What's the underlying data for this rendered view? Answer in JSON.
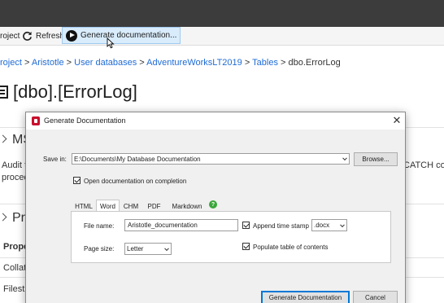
{
  "toolbar": {
    "project_label": "roject",
    "refresh_label": "Refresh",
    "generate_label": "Generate documentation..."
  },
  "breadcrumb": {
    "items": [
      "roject",
      "Aristotle",
      "User databases",
      "AdventureWorksLT2019",
      "Tables",
      "dbo.ErrorLog"
    ],
    "separator": ">"
  },
  "page": {
    "title": "[dbo].[ErrorLog]",
    "section_ms": "MS",
    "desc_line1": "Audit ta",
    "desc_line2": "proced",
    "desc_right": "CATCH co",
    "section_pro": "Pro",
    "col_prope": "Prope",
    "row_collat": "Collati",
    "row_filestr": "Filestr"
  },
  "dialog": {
    "title": "Generate Documentation",
    "close_glyph": "✕",
    "save_in_label": "Save in:",
    "save_in_value": "E:\\Documents\\My Database Documentation",
    "browse_label": "Browse...",
    "open_doc_label": "Open documentation on completion",
    "open_doc_checked": true,
    "tabs": [
      "HTML",
      "Word",
      "CHM",
      "PDF",
      "Markdown"
    ],
    "active_tab": "Word",
    "help_glyph": "?",
    "file_name_label": "File name:",
    "file_name_value": "Aristotle_documentation",
    "append_timestamp_label": "Append time stamp",
    "append_timestamp_checked": true,
    "extension_value": ".docx",
    "page_size_label": "Page size:",
    "page_size_value": "Letter",
    "populate_toc_label": "Populate table of contents",
    "populate_toc_checked": true,
    "generate_button": "Generate Documentation",
    "cancel_button": "Cancel"
  },
  "colors": {
    "link": "#1e6bd6",
    "titlebar": "#3c3c3c",
    "accent": "#0078d7",
    "brand": "#c8102e",
    "help": "#3aa63a"
  }
}
